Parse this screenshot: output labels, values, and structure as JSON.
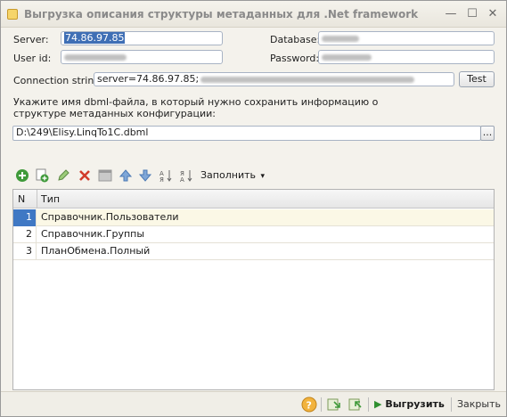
{
  "window": {
    "title": "Выгрузка описания структуры метаданных для  .Net framework",
    "minimize": "—",
    "maximize": "☐",
    "close": "✕"
  },
  "form": {
    "server_label": "Server:",
    "server_value": "74.86.97.85",
    "database_label": "Database:",
    "userid_label": "User id:",
    "password_label": "Password:",
    "connection_label": "Connection string:",
    "connection_value": "server=74.86.97.85;",
    "test_button": "Test",
    "hint_line1": "Укажите имя dbml-файла, в который нужно сохранить информацию о",
    "hint_line2": "структуре метаданных конфигурации:",
    "file_path": "D:\\249\\Elisy.LinqTo1C.dbml",
    "browse_button": "..."
  },
  "toolbar": {
    "fill_label": "Заполнить",
    "fill_arrow": "▾"
  },
  "grid": {
    "col_n": "N",
    "col_type": "Тип",
    "rows": [
      {
        "n": "1",
        "type": "Справочник.Пользователи"
      },
      {
        "n": "2",
        "type": "Справочник.Группы"
      },
      {
        "n": "3",
        "type": "ПланОбмена.Полный"
      }
    ]
  },
  "footer": {
    "help": "?",
    "export_label": "Выгрузить",
    "close_label": "Закрыть"
  },
  "colors": {
    "accent": "#3f78c4",
    "add_green": "#3f9a3a",
    "delete_red": "#d23b2b"
  }
}
